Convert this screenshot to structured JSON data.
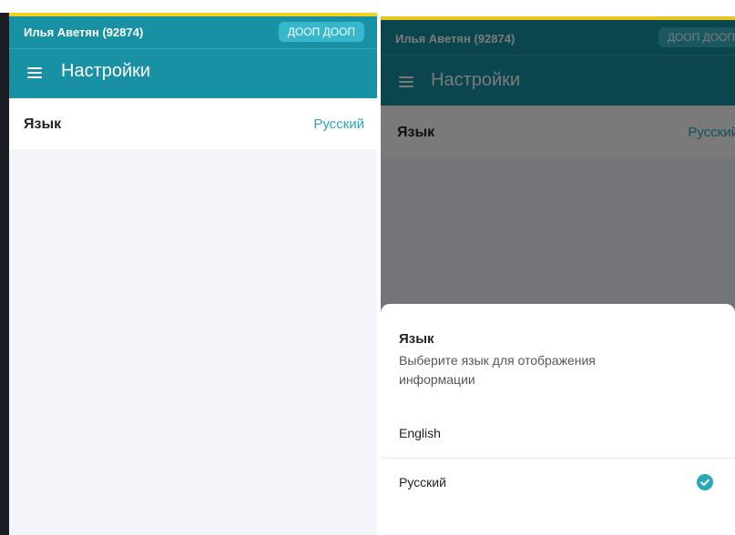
{
  "header": {
    "user_name": "Илья Аветян (92874)",
    "org_button": "ДООП ДООП",
    "title": "Настройки",
    "menu_icon": "hamburger-menu-icon"
  },
  "settings": {
    "language_label": "Язык",
    "language_value": "Русский"
  },
  "language_sheet": {
    "title": "Язык",
    "description": "Выберите язык для отображения информации",
    "options": [
      {
        "label": "English",
        "selected": false
      },
      {
        "label": "Русский",
        "selected": true
      }
    ],
    "check_icon": "check-circle-icon"
  },
  "colors": {
    "header_bg": "#1791a3",
    "accent_line": "#f0d21f",
    "link_value": "#2aa7bb",
    "page_bg": "#f3f5fa"
  }
}
